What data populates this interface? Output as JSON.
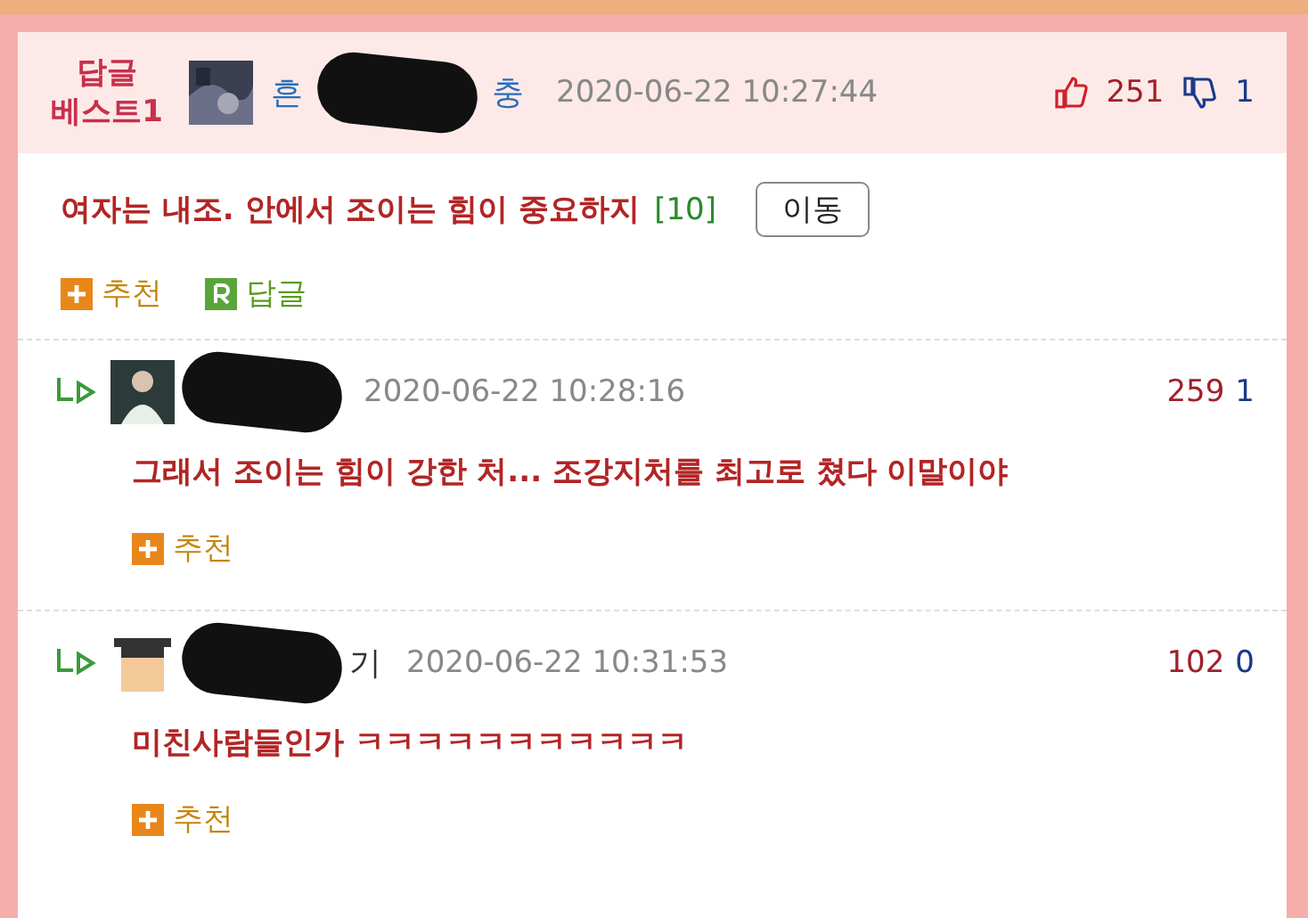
{
  "best_comment": {
    "badge_lines": [
      "답글",
      "베스트1"
    ],
    "name_before": "흔",
    "name_after": "충",
    "date": "2020-06-22 10:27:44",
    "likes": "251",
    "dislikes": "1",
    "text": "여자는 내조. 안에서 조이는 힘이 중요하지",
    "reply_count": "[10]",
    "move_button": "이동",
    "actions": [
      {
        "kind": "recommend",
        "label": "추천"
      },
      {
        "kind": "reply",
        "label": "답글"
      }
    ]
  },
  "replies": [
    {
      "date": "2020-06-22 10:28:16",
      "likes": "259",
      "dislikes": "1",
      "text": "그래서 조이는 힘이 강한 처... 조강지처를 최고로 쳤다 이말이야",
      "actions": [
        {
          "kind": "recommend",
          "label": "추천"
        }
      ]
    },
    {
      "name_after": "기",
      "date": "2020-06-22 10:31:53",
      "likes": "102",
      "dislikes": "0",
      "text": "미친사람들인가 ㅋㅋㅋㅋㅋㅋㅋㅋㅋㅋㅋ",
      "actions": [
        {
          "kind": "recommend",
          "label": "추천"
        }
      ]
    }
  ]
}
